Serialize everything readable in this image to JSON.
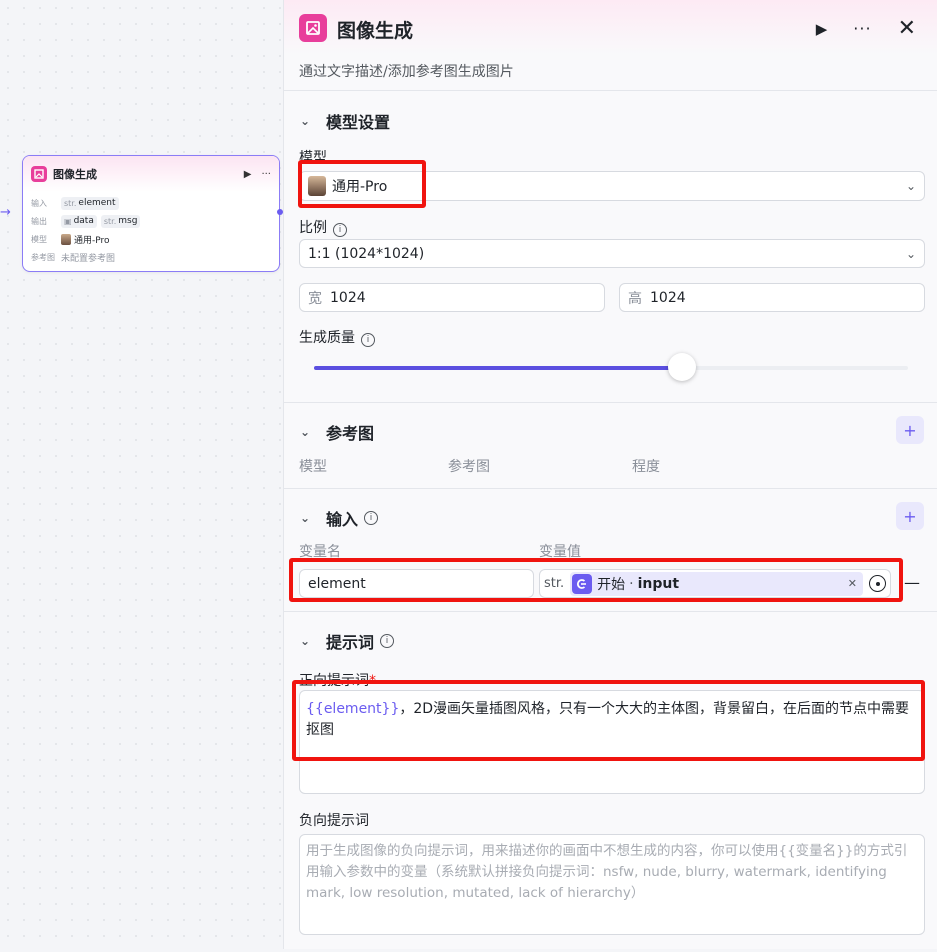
{
  "node": {
    "title": "图像生成",
    "input_label": "输入",
    "input_type": "str.",
    "input_value": "element",
    "output_label": "输出",
    "output_data": "data",
    "output_msg_type": "str.",
    "output_msg": "msg",
    "model_label": "模型",
    "model_value": "通用-Pro",
    "ref_label": "参考图",
    "ref_value": "未配置参考图"
  },
  "panel": {
    "title": "图像生成",
    "subtitle": "通过文字描述/添加参考图生成图片"
  },
  "model_section": {
    "title": "模型设置",
    "model_label": "模型",
    "model_value": "通用-Pro",
    "ratio_label": "比例",
    "ratio_value": "1:1 (1024*1024)",
    "width_label": "宽",
    "width_value": "1024",
    "height_label": "高",
    "height_value": "1024",
    "quality_label": "生成质量",
    "quality_level": 0.62
  },
  "ref_section": {
    "title": "参考图",
    "col_model": "模型",
    "col_image": "参考图",
    "col_degree": "程度"
  },
  "input_section": {
    "title": "输入",
    "col_name": "变量名",
    "col_value": "变量值",
    "var_name": "element",
    "var_type": "str.",
    "var_source": "开始",
    "var_sep": "·",
    "var_field": "input"
  },
  "prompt_section": {
    "title": "提示词",
    "positive_label": "正向提示词",
    "required_mark": "*",
    "positive_var": "{{element}}",
    "positive_text": "，2D漫画矢量插图风格，只有一个大大的主体图，背景留白，在后面的节点中需要抠图",
    "negative_label": "负向提示词",
    "negative_placeholder": "用于生成图像的负向提示词，用来描述你的画面中不想生成的内容，你可以使用{{变量名}}的方式引用输入参数中的变量（系统默认拼接负向提示词：nsfw, nude, blurry, watermark, identifying mark, low resolution, mutated, lack of hierarchy）"
  },
  "colors": {
    "accent": "#6b5cf0",
    "brand": "#e83e9b",
    "highlight": "#f0140f"
  }
}
